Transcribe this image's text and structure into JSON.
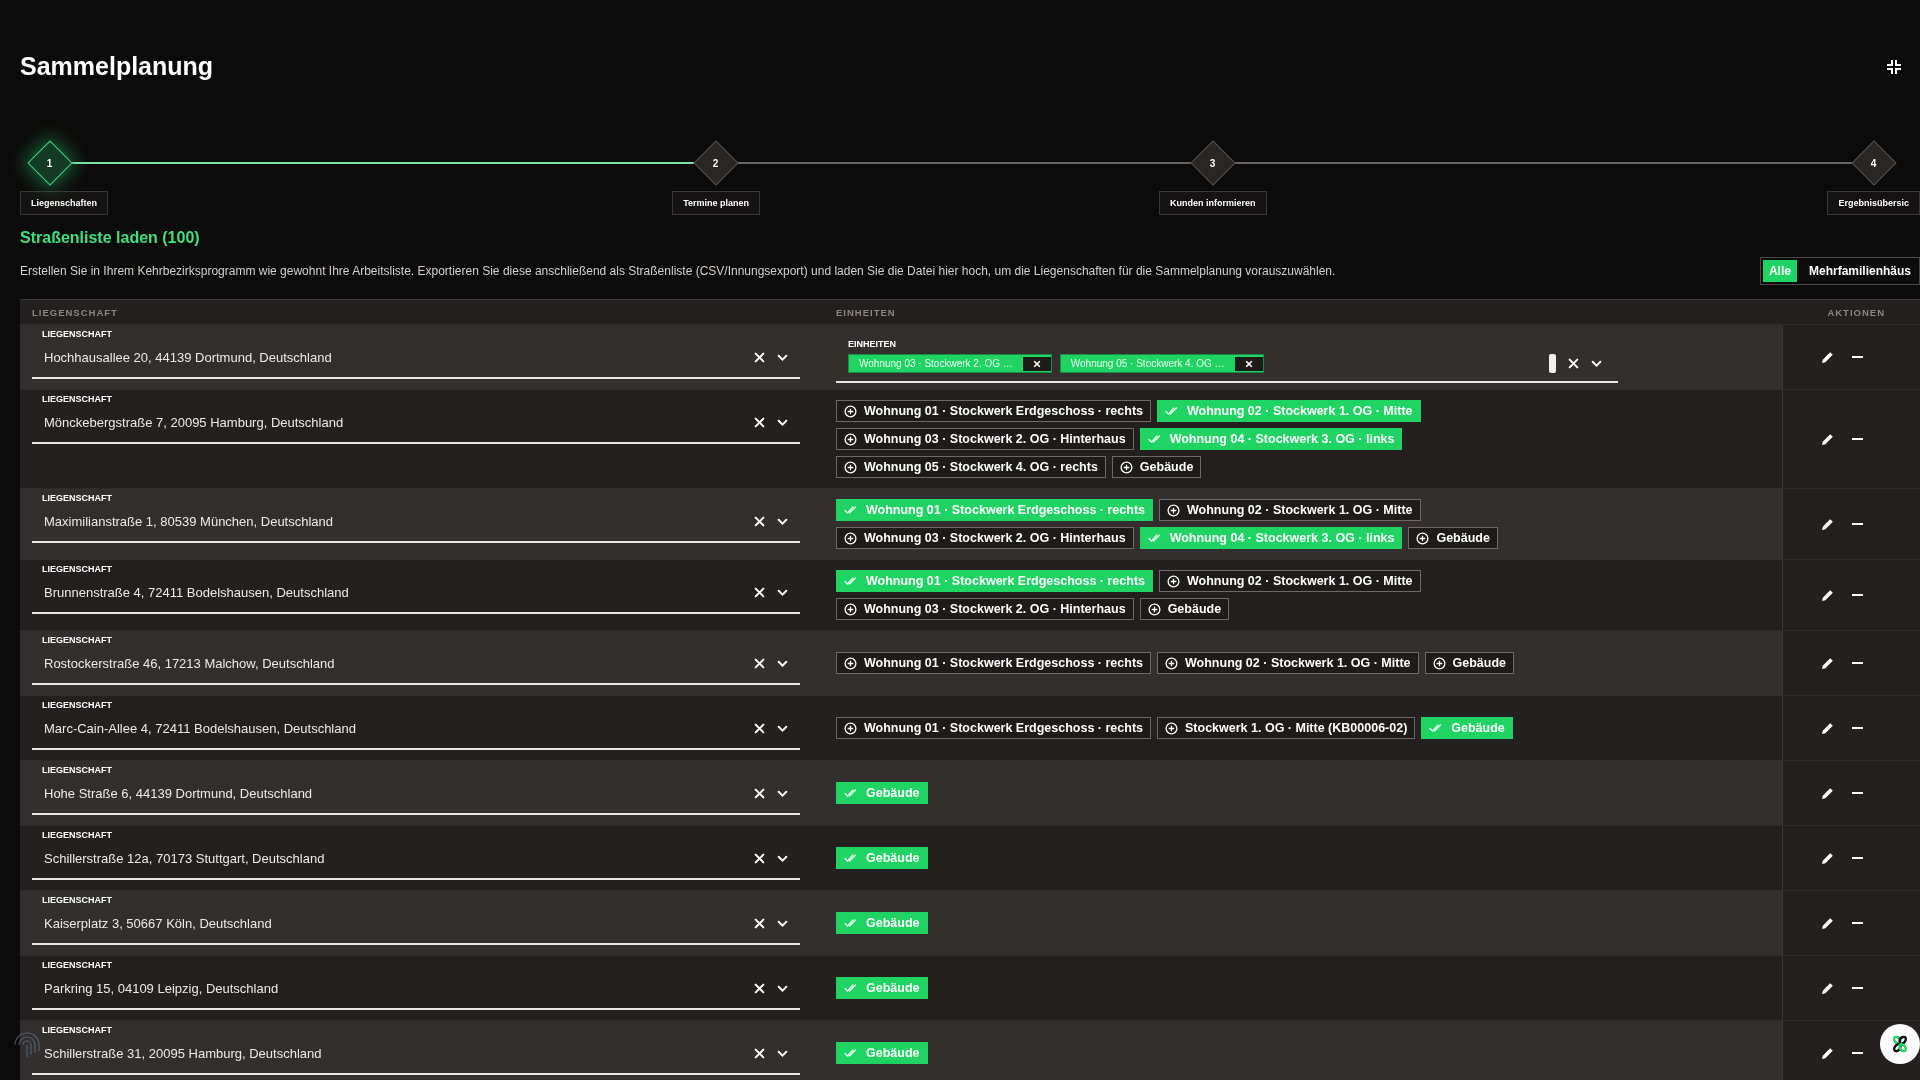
{
  "title": "Sammelplanung",
  "steps": [
    {
      "number": "1",
      "label": "Liegenschaften",
      "selected": true
    },
    {
      "number": "2",
      "label": "Termine planen",
      "selected": false
    },
    {
      "number": "3",
      "label": "Kunden informieren",
      "selected": false
    },
    {
      "number": "4",
      "label": "Ergebnisübersic",
      "selected": false
    }
  ],
  "section": {
    "heading": "Straßenliste laden (100)",
    "description": "Erstellen Sie in Ihrem Kehrbezirksprogramm wie gewohnt Ihre Arbeitsliste. Exportieren Sie diese anschließend als Straßenliste (CSV/Innungsexport) und laden Sie die Datei hier hoch, um die Liegenschaften für die Sammelplanung vorauszuwählen."
  },
  "filter": [
    {
      "label": "Alle",
      "selected": true
    },
    {
      "label": "Mehrfamilienhäus",
      "selected": false
    }
  ],
  "table": {
    "columns": [
      "LIEGENSCHAFT",
      "EINHEITEN",
      "AKTIONEN"
    ],
    "rows": [
      {
        "property_label": "LIEGENSCHAFT",
        "address": "Hochhausallee 20, 44139 Dortmund, Deutschland",
        "kind": "field",
        "units_label": "EINHEITEN",
        "tags": [
          "Wohnung 03 · Stockwerk 2. OG …",
          "Wohnung 05 · Stockwerk 4. OG …"
        ]
      },
      {
        "property_label": "LIEGENSCHAFT",
        "address": "Mönckebergstraße 7, 20095 Hamburg, Deutschland",
        "kind": "chips",
        "units": [
          {
            "label": "Wohnung 01 · Stockwerk Erdgeschoss · rechts",
            "selected": false
          },
          {
            "label": "Wohnung 02 · Stockwerk 1. OG · Mitte",
            "selected": true
          },
          {
            "label": "Wohnung 03 · Stockwerk 2. OG · Hinterhaus",
            "selected": false
          },
          {
            "label": "Wohnung 04 · Stockwerk 3. OG · links",
            "selected": true
          },
          {
            "label": "Wohnung 05 · Stockwerk 4. OG · rechts",
            "selected": false
          },
          {
            "label": "Gebäude",
            "selected": false
          }
        ]
      },
      {
        "property_label": "LIEGENSCHAFT",
        "address": "Maximilianstraße 1, 80539 München, Deutschland",
        "kind": "chips",
        "units": [
          {
            "label": "Wohnung 01 · Stockwerk Erdgeschoss · rechts",
            "selected": true
          },
          {
            "label": "Wohnung 02 · Stockwerk 1. OG · Mitte",
            "selected": false
          },
          {
            "label": "Wohnung 03 · Stockwerk 2. OG · Hinterhaus",
            "selected": false
          },
          {
            "label": "Wohnung 04 · Stockwerk 3. OG · links",
            "selected": true
          },
          {
            "label": "Gebäude",
            "selected": false
          }
        ]
      },
      {
        "property_label": "LIEGENSCHAFT",
        "address": "Brunnenstraße 4, 72411 Bodelshausen, Deutschland",
        "kind": "chips",
        "units": [
          {
            "label": "Wohnung 01 · Stockwerk Erdgeschoss · rechts",
            "selected": true
          },
          {
            "label": "Wohnung 02 · Stockwerk 1. OG · Mitte",
            "selected": false
          },
          {
            "label": "Wohnung 03 · Stockwerk 2. OG · Hinterhaus",
            "selected": false
          },
          {
            "label": "Gebäude",
            "selected": false
          }
        ]
      },
      {
        "property_label": "LIEGENSCHAFT",
        "address": "Rostockerstraße 46, 17213 Malchow, Deutschland",
        "kind": "chips",
        "units": [
          {
            "label": "Wohnung 01 · Stockwerk Erdgeschoss · rechts",
            "selected": false
          },
          {
            "label": "Wohnung 02 · Stockwerk 1. OG · Mitte",
            "selected": false
          },
          {
            "label": "Gebäude",
            "selected": false
          }
        ]
      },
      {
        "property_label": "LIEGENSCHAFT",
        "address": "Marc-Cain-Allee 4, 72411 Bodelshausen, Deutschland",
        "kind": "chips",
        "units": [
          {
            "label": "Wohnung 01 · Stockwerk Erdgeschoss · rechts",
            "selected": false
          },
          {
            "label": "Stockwerk 1. OG · Mitte (KB00006-02)",
            "selected": false
          },
          {
            "label": "Gebäude",
            "selected": true
          }
        ]
      },
      {
        "property_label": "LIEGENSCHAFT",
        "address": "Hohe Straße 6, 44139 Dortmund, Deutschland",
        "kind": "chips",
        "units": [
          {
            "label": "Gebäude",
            "selected": true
          }
        ]
      },
      {
        "property_label": "LIEGENSCHAFT",
        "address": "Schillerstraße 12a, 70173 Stuttgart, Deutschland",
        "kind": "chips",
        "units": [
          {
            "label": "Gebäude",
            "selected": true
          }
        ]
      },
      {
        "property_label": "LIEGENSCHAFT",
        "address": "Kaiserplatz 3, 50667 Köln, Deutschland",
        "kind": "chips",
        "units": [
          {
            "label": "Gebäude",
            "selected": true
          }
        ]
      },
      {
        "property_label": "LIEGENSCHAFT",
        "address": "Parkring 15, 04109 Leipzig, Deutschland",
        "kind": "chips",
        "units": [
          {
            "label": "Gebäude",
            "selected": true
          }
        ]
      },
      {
        "property_label": "LIEGENSCHAFT",
        "address": "Schillerstraße 31, 20095 Hamburg, Deutschland",
        "kind": "chips",
        "units": [
          {
            "label": "Gebäude",
            "selected": true
          }
        ]
      }
    ]
  }
}
